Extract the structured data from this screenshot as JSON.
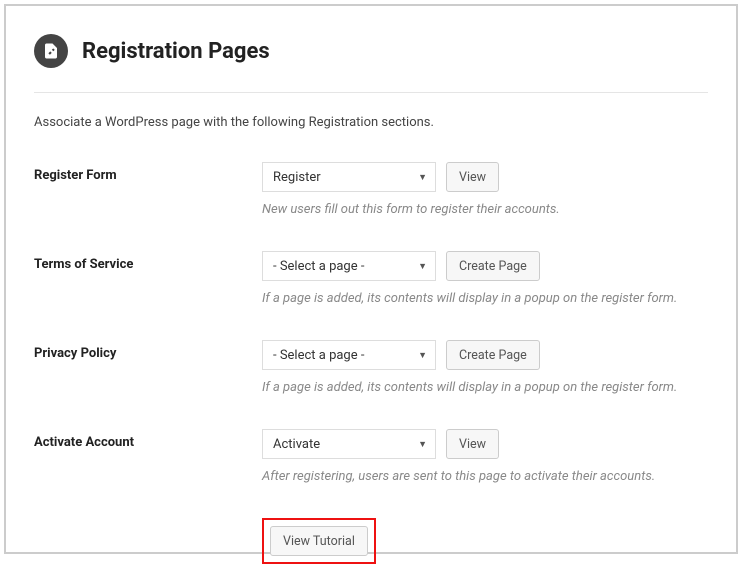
{
  "header": {
    "title": "Registration Pages"
  },
  "description": "Associate a WordPress page with the following Registration sections.",
  "rows": {
    "register": {
      "label": "Register Form",
      "selected": "Register",
      "button": "View",
      "help": "New users fill out this form to register their accounts."
    },
    "terms": {
      "label": "Terms of Service",
      "selected": "- Select a page -",
      "button": "Create Page",
      "help": "If a page is added, its contents will display in a popup on the register form."
    },
    "privacy": {
      "label": "Privacy Policy",
      "selected": "- Select a page -",
      "button": "Create Page",
      "help": "If a page is added, its contents will display in a popup on the register form."
    },
    "activate": {
      "label": "Activate Account",
      "selected": "Activate",
      "button": "View",
      "help": "After registering, users are sent to this page to activate their accounts."
    }
  },
  "footer": {
    "tutorial": "View Tutorial"
  }
}
